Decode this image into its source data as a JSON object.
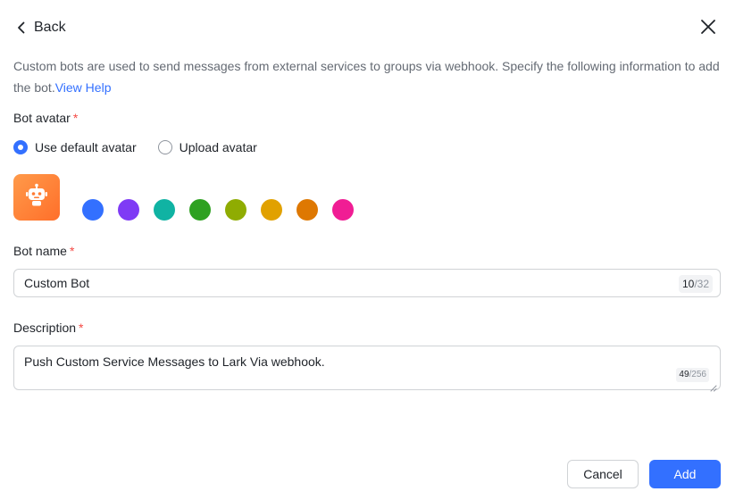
{
  "header": {
    "back_label": "Back",
    "back_icon": "chevron-left-icon",
    "close_icon": "close-icon"
  },
  "intro": {
    "text": "Custom bots are used to send messages from external services to groups via webhook. Specify the following information to add the bot.",
    "link_label": "View Help",
    "link_color": "#3370ff"
  },
  "avatar_section": {
    "label": "Bot avatar",
    "required_mark": "*",
    "options": [
      {
        "label": "Use default avatar",
        "checked": true
      },
      {
        "label": "Upload avatar",
        "checked": false
      }
    ],
    "preview_icon": "robot-icon",
    "preview_colors": [
      "#ff9a4a",
      "#ff6f2a"
    ],
    "swatches": [
      {
        "name": "blue",
        "color": "#3370ff"
      },
      {
        "name": "purple",
        "color": "#7f3bf5"
      },
      {
        "name": "teal",
        "color": "#10b3a3"
      },
      {
        "name": "green",
        "color": "#2ea121"
      },
      {
        "name": "olive",
        "color": "#8fac02"
      },
      {
        "name": "amber",
        "color": "#e1a100"
      },
      {
        "name": "orange",
        "color": "#de7802"
      },
      {
        "name": "pink",
        "color": "#f01d94"
      }
    ]
  },
  "bot_name": {
    "label": "Bot name",
    "required_mark": "*",
    "value": "Custom Bot",
    "count": "10",
    "max": "/32"
  },
  "description": {
    "label": "Description",
    "required_mark": "*",
    "value": "Push Custom Service Messages to Lark Via webhook.",
    "count": "49",
    "max": "/256"
  },
  "footer": {
    "cancel_label": "Cancel",
    "add_label": "Add",
    "primary_color": "#3370ff"
  }
}
